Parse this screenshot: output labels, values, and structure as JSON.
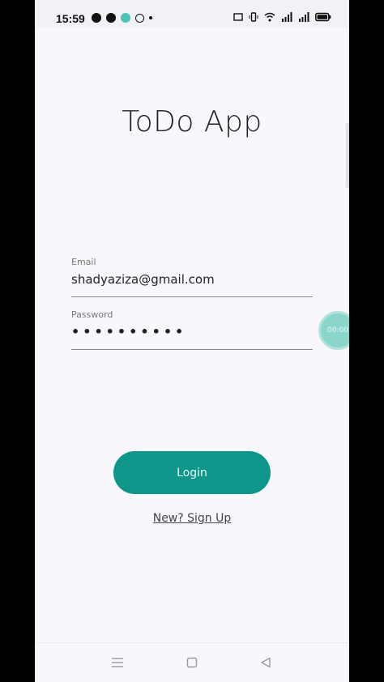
{
  "status_bar": {
    "time": "15:59"
  },
  "app": {
    "title": "ToDo App"
  },
  "form": {
    "email_label": "Email",
    "email_value": "shadyaziza@gmail.com",
    "password_label": "Password",
    "password_value": "••••••••••"
  },
  "floating_bubble": {
    "text": "00:00"
  },
  "actions": {
    "login_label": "Login",
    "signup_label": "New? Sign Up"
  },
  "colors": {
    "accent": "#0f968a",
    "background": "#f8f7fb"
  },
  "icons": {
    "nav_menu": "menu-icon",
    "nav_home": "home-square-icon",
    "nav_back": "back-triangle-icon"
  }
}
